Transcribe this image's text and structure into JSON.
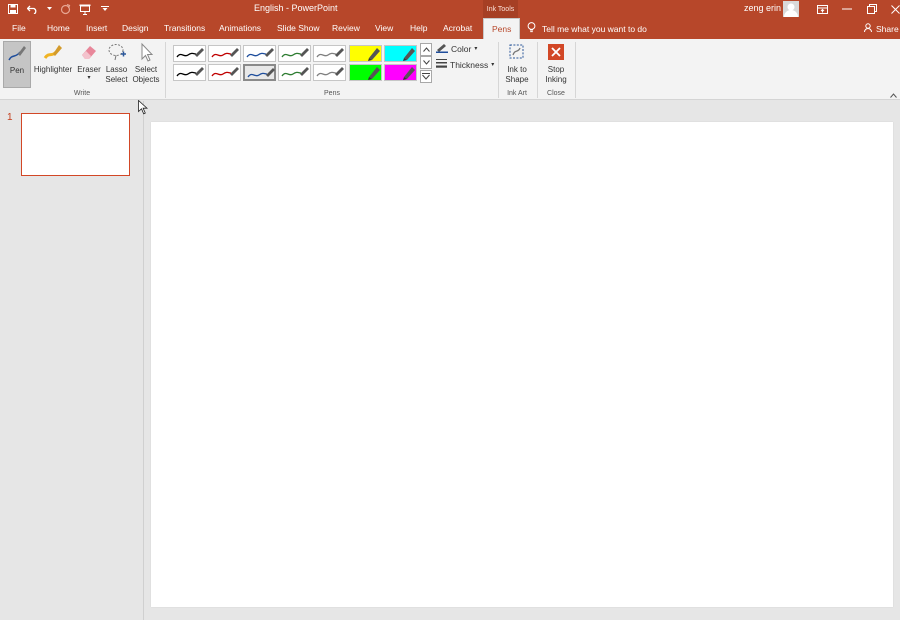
{
  "titlebar": {
    "title": "English  -  PowerPoint",
    "context_tab": "Ink Tools",
    "user": "zeng erin",
    "accent": "#b7472a"
  },
  "tabs": [
    "File",
    "Home",
    "Insert",
    "Design",
    "Transitions",
    "Animations",
    "Slide Show",
    "Review",
    "View",
    "Help",
    "Acrobat",
    "Pens"
  ],
  "active_tab": "Pens",
  "tell_me": "Tell me what you want to do",
  "share": "Share",
  "ribbon": {
    "write": {
      "label": "Write",
      "pen": "Pen",
      "highlighter": "Highlighter",
      "eraser": "Eraser",
      "lasso_1": "Lasso",
      "lasso_2": "Select",
      "select_1": "Select",
      "select_2": "Objects"
    },
    "pens": {
      "label": "Pens",
      "color": "Color",
      "thickness": "Thickness",
      "swatch_colors": [
        "#000000",
        "#c00000",
        "#1f4e9c",
        "#2e7d32",
        "#808080",
        "#ffff00",
        "#00ffff",
        "#000000",
        "#c00000",
        "#1f4e9c",
        "#2e7d32",
        "#808080",
        "#00ff00",
        "#ff00ff"
      ]
    },
    "ink_art": {
      "label": "Ink Art",
      "btn_1": "Ink to",
      "btn_2": "Shape"
    },
    "close": {
      "label": "Close",
      "btn_1": "Stop",
      "btn_2": "Inking"
    }
  },
  "thumbnails": {
    "slide_number": "1"
  }
}
